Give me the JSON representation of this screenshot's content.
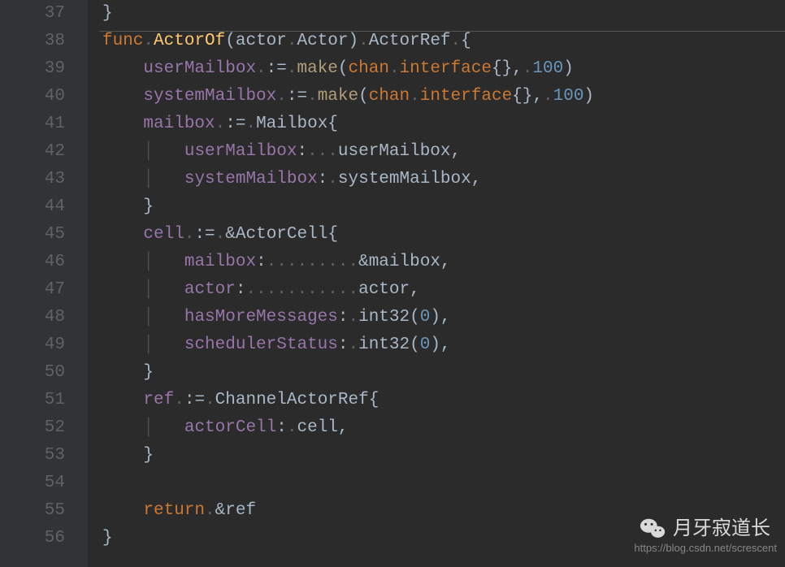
{
  "gutter": {
    "start": 37,
    "end": 56
  },
  "code": {
    "l37": "}",
    "l38": {
      "func": "func",
      "name": "ActorOf",
      "lp": "(",
      "param": "actor",
      "ptype": "Actor",
      "rp": ")",
      "ret": "ActorRef",
      "ob": "{"
    },
    "l39": {
      "v": "userMailbox",
      "assign": ":=",
      "make": "make",
      "lp": "(",
      "chan": "chan",
      "iface": "interface",
      "br": "{}",
      "comma": ",",
      "num": "100",
      "rp": ")"
    },
    "l40": {
      "v": "systemMailbox",
      "assign": ":=",
      "make": "make",
      "lp": "(",
      "chan": "chan",
      "iface": "interface",
      "br": "{}",
      "comma": ",",
      "num": "100",
      "rp": ")"
    },
    "l41": {
      "v": "mailbox",
      "assign": ":=",
      "typ": "Mailbox",
      "ob": "{"
    },
    "l42": {
      "key": "userMailbox",
      "val": "userMailbox"
    },
    "l43": {
      "key": "systemMailbox",
      "val": "systemMailbox"
    },
    "l44": "}",
    "l45": {
      "v": "cell",
      "assign": ":=",
      "amp": "&",
      "typ": "ActorCell",
      "ob": "{"
    },
    "l46": {
      "key": "mailbox",
      "amp": "&",
      "val": "mailbox"
    },
    "l47": {
      "key": "actor",
      "val": "actor"
    },
    "l48": {
      "key": "hasMoreMessages",
      "call": "int32",
      "num": "0"
    },
    "l49": {
      "key": "schedulerStatus",
      "call": "int32",
      "num": "0"
    },
    "l50": "}",
    "l51": {
      "v": "ref",
      "assign": ":=",
      "typ": "ChannelActorRef",
      "ob": "{"
    },
    "l52": {
      "key": "actorCell",
      "val": "cell"
    },
    "l53": "}",
    "l55": {
      "ret": "return",
      "amp": "&",
      "val": "ref"
    },
    "l56": "}"
  },
  "watermark": {
    "text": "月牙寂道长",
    "url": "https://blog.csdn.net/screscent"
  },
  "dots": {
    "d1": ".",
    "d3": "...",
    "d7": ".......",
    "d9": "........."
  }
}
